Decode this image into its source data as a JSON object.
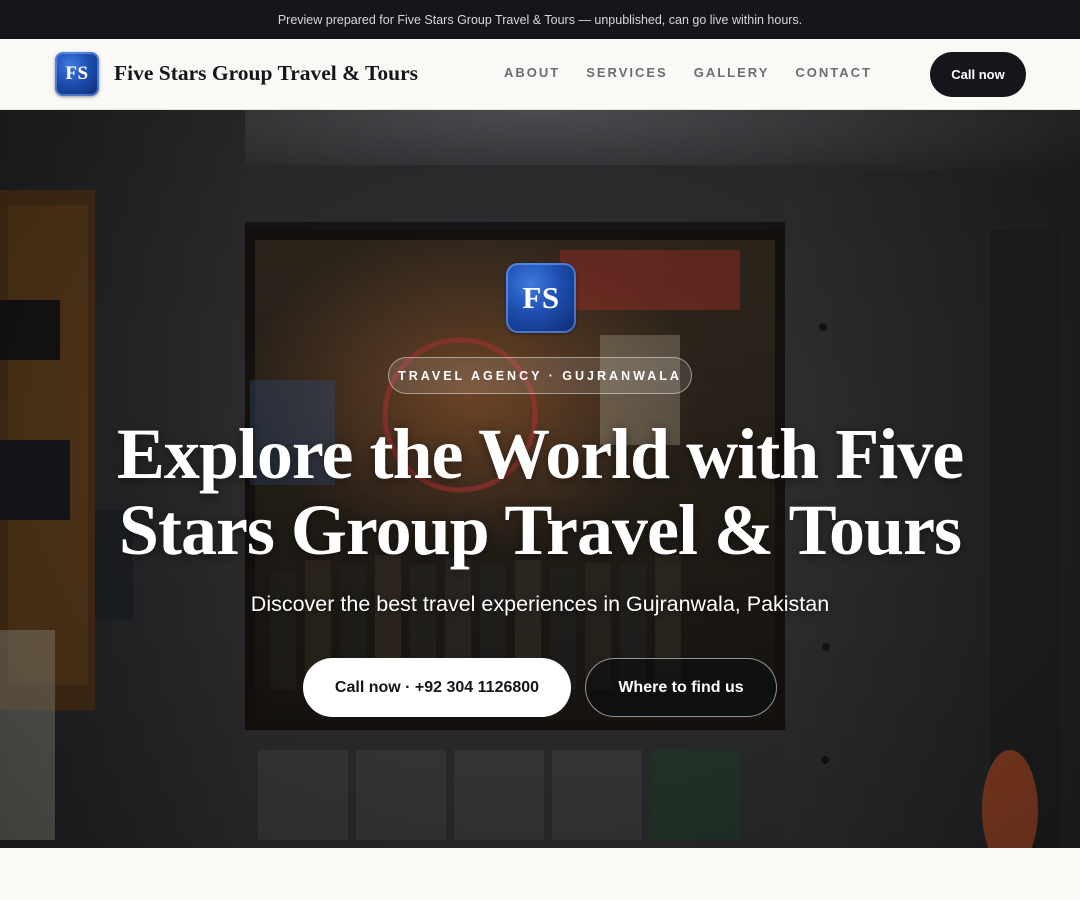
{
  "preview_banner": {
    "text": "Preview prepared for Five Stars Group Travel & Tours — unpublished, can go live within hours."
  },
  "header": {
    "logo_text": "FS",
    "brand_name": "Five Stars Group Travel & Tours",
    "nav": [
      {
        "label": "ABOUT"
      },
      {
        "label": "SERVICES"
      },
      {
        "label": "GALLERY"
      },
      {
        "label": "CONTACT"
      }
    ],
    "cta_label": "Call now"
  },
  "hero": {
    "logo_text": "FS",
    "eyebrow": "TRAVEL AGENCY · GUJRANWALA",
    "title": "Explore the World with Five Stars Group Travel & Tours",
    "subtitle": "Discover the best travel experiences in Gujranwala, Pakistan",
    "primary_button": "Call now · +92 304 1126800",
    "secondary_button": "Where to find us"
  },
  "colors": {
    "banner_bg": "#14161b",
    "page_bg": "#faf9f6",
    "brand_dark": "#14161b",
    "nav_text": "#6a6d73",
    "logo_blue": "#1d4eb0"
  }
}
